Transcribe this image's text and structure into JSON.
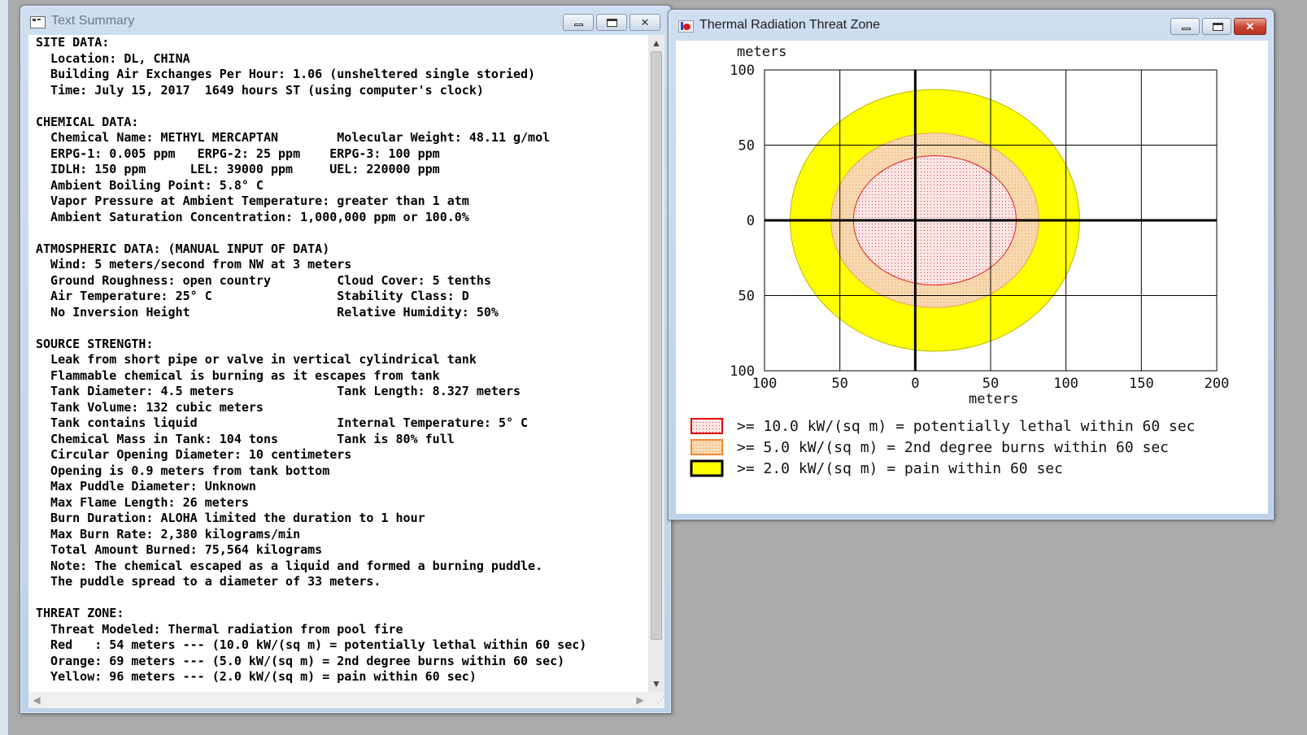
{
  "text_window": {
    "title": "Text Summary",
    "lines": [
      "SITE DATA:",
      "  Location: DL, CHINA",
      "  Building Air Exchanges Per Hour: 1.06 (unsheltered single storied)",
      "  Time: July 15, 2017  1649 hours ST (using computer's clock)",
      "",
      "CHEMICAL DATA:",
      "  Chemical Name: METHYL MERCAPTAN        Molecular Weight: 48.11 g/mol",
      "  ERPG-1: 0.005 ppm   ERPG-2: 25 ppm    ERPG-3: 100 ppm",
      "  IDLH: 150 ppm      LEL: 39000 ppm     UEL: 220000 ppm",
      "  Ambient Boiling Point: 5.8° C",
      "  Vapor Pressure at Ambient Temperature: greater than 1 atm",
      "  Ambient Saturation Concentration: 1,000,000 ppm or 100.0%",
      "",
      "ATMOSPHERIC DATA: (MANUAL INPUT OF DATA)",
      "  Wind: 5 meters/second from NW at 3 meters",
      "  Ground Roughness: open country         Cloud Cover: 5 tenths",
      "  Air Temperature: 25° C                 Stability Class: D",
      "  No Inversion Height                    Relative Humidity: 50%",
      "",
      "SOURCE STRENGTH:",
      "  Leak from short pipe or valve in vertical cylindrical tank",
      "  Flammable chemical is burning as it escapes from tank",
      "  Tank Diameter: 4.5 meters              Tank Length: 8.327 meters",
      "  Tank Volume: 132 cubic meters",
      "  Tank contains liquid                   Internal Temperature: 5° C",
      "  Chemical Mass in Tank: 104 tons        Tank is 80% full",
      "  Circular Opening Diameter: 10 centimeters",
      "  Opening is 0.9 meters from tank bottom",
      "  Max Puddle Diameter: Unknown",
      "  Max Flame Length: 26 meters",
      "  Burn Duration: ALOHA limited the duration to 1 hour",
      "  Max Burn Rate: 2,380 kilograms/min",
      "  Total Amount Burned: 75,564 kilograms",
      "  Note: The chemical escaped as a liquid and formed a burning puddle.",
      "  The puddle spread to a diameter of 33 meters.",
      "",
      "THREAT ZONE:",
      "  Threat Modeled: Thermal radiation from pool fire",
      "  Red   : 54 meters --- (10.0 kW/(sq m) = potentially lethal within 60 sec)",
      "  Orange: 69 meters --- (5.0 kW/(sq m) = 2nd degree burns within 60 sec)",
      "  Yellow: 96 meters --- (2.0 kW/(sq m) = pain within 60 sec)"
    ]
  },
  "threat_window": {
    "title": "Thermal Radiation Threat Zone"
  },
  "chart_data": {
    "type": "area",
    "ylabel": "meters",
    "xlabel": "meters",
    "x_ticks": [
      "100",
      "50",
      "0",
      "50",
      "100",
      "150",
      "200"
    ],
    "y_ticks": [
      "100",
      "50",
      "0",
      "50",
      "100"
    ],
    "xlim": [
      -100,
      200
    ],
    "ylim": [
      -100,
      100
    ],
    "zones": [
      {
        "name": ">= 2.0 kW/(sq m) = pain within 60 sec",
        "color": "#ffff00",
        "edge": "#b8b800",
        "center_x": 13,
        "center_y": 0,
        "radius_x": 96,
        "radius_y": 87
      },
      {
        "name": ">= 5.0 kW/(sq m) = 2nd degree burns within 60 sec",
        "color": "#f7d9b0",
        "edge": "#f0a060",
        "center_x": 13,
        "center_y": 0,
        "radius_x": 69,
        "radius_y": 58
      },
      {
        "name": ">= 10.0 kW/(sq m) = potentially lethal within 60 sec",
        "color": "#fbe6e6",
        "edge": "#e22424",
        "center_x": 13,
        "center_y": 0,
        "radius_x": 54,
        "radius_y": 43
      }
    ],
    "legend": [
      {
        "label": ">= 10.0 kW/(sq m) = potentially lethal within 60 sec",
        "fill": "#fbd6d6",
        "stroke": "#e00000"
      },
      {
        "label": ">= 5.0 kW/(sq m) = 2nd degree burns within 60 sec",
        "fill": "#f9d2a0",
        "stroke": "#f08a30"
      },
      {
        "label": ">= 2.0 kW/(sq m) = pain within 60 sec",
        "fill": "#ffff00",
        "stroke": "#000000"
      }
    ]
  }
}
